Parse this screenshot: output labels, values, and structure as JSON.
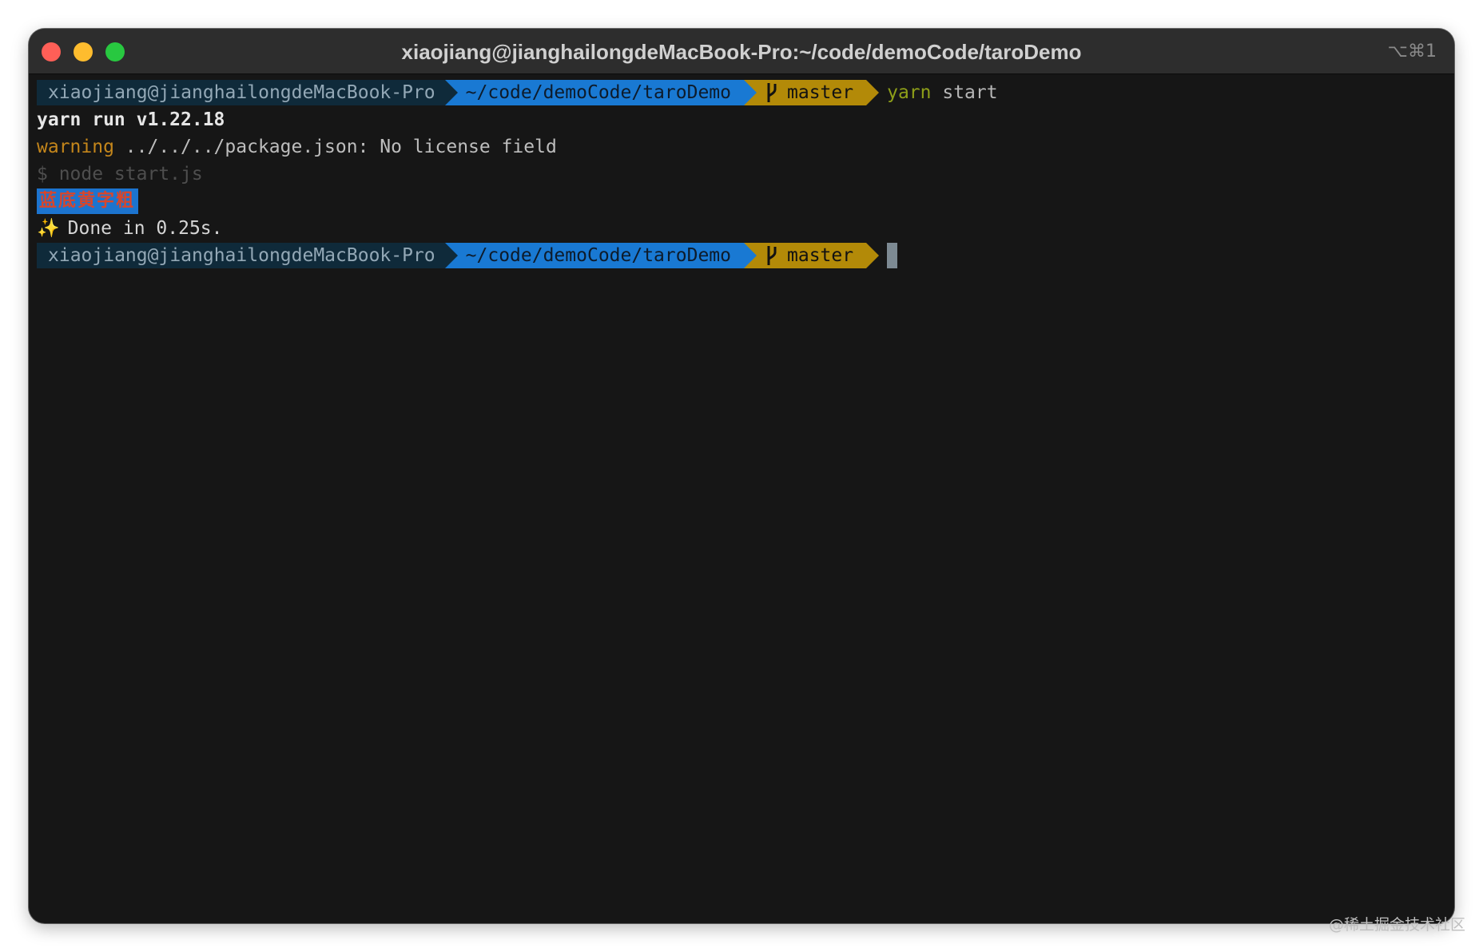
{
  "window": {
    "title": "xiaojiang@jianghailongdeMacBook-Pro:~/code/demoCode/taroDemo",
    "shortcut": "⌥⌘1"
  },
  "prompt": {
    "user_host": "xiaojiang@jianghailongdeMacBook-Pro",
    "path": "~/code/demoCode/taroDemo",
    "branch": "master",
    "branch_icon": "git-branch-icon"
  },
  "command": {
    "program": "yarn",
    "args": "start"
  },
  "output": {
    "yarn_run": "yarn run v1.22.18",
    "warning_label": "warning",
    "warning_text": " ../../../package.json: No license field",
    "node_cmd": "$ node start.js",
    "styled_text": "蓝底黄字粗",
    "sparkle": "✨",
    "done": "Done in 0.25s."
  },
  "watermark": "@稀土掘金技术社区",
  "colors": {
    "terminal_bg": "#161616",
    "titlebar_bg": "#2d2d2d",
    "user_segment": "#0f2a3a",
    "path_segment": "#1979d3",
    "git_segment": "#b38a08",
    "warning": "#c4861b",
    "yarn_cmd": "#8e9f19"
  }
}
